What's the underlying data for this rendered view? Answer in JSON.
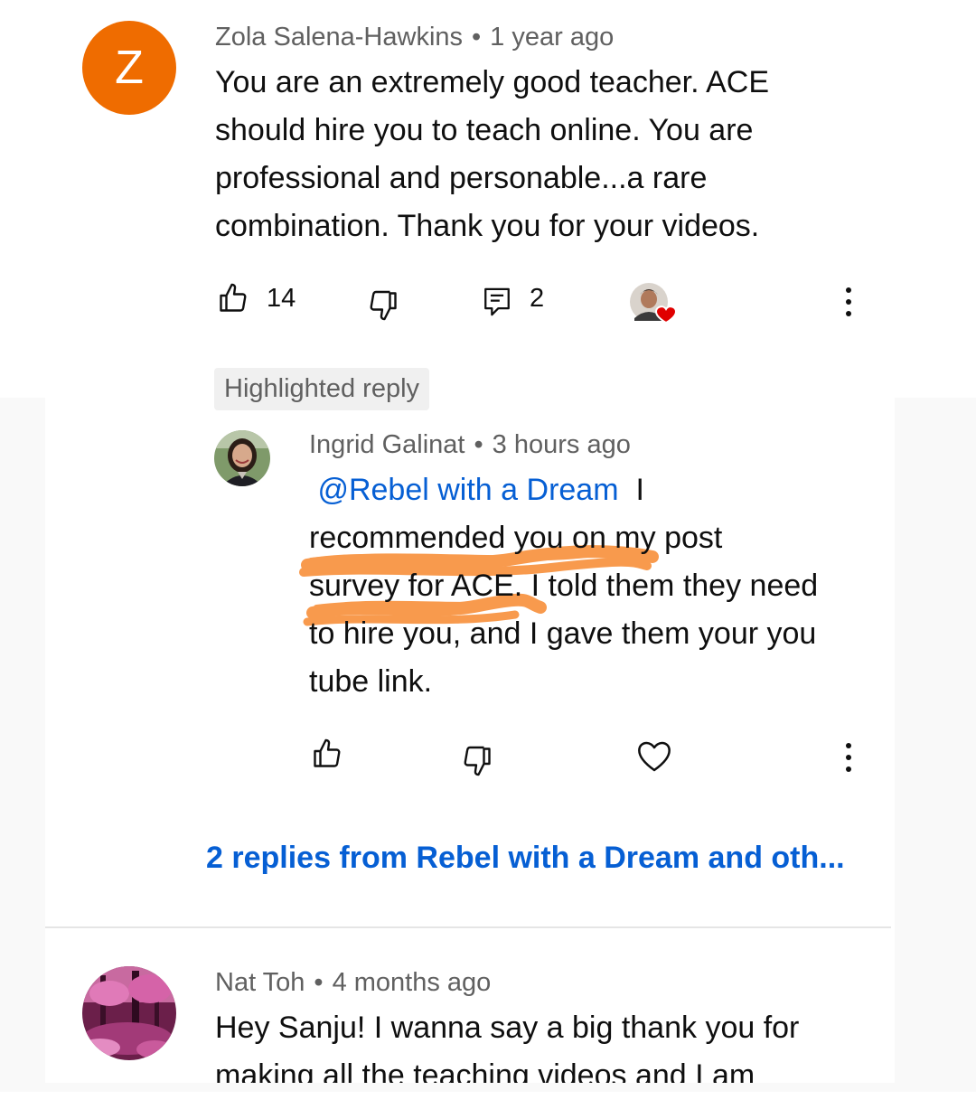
{
  "comment1": {
    "avatar_letter": "Z",
    "avatar_color": "#ef6c00",
    "author": "Zola Salena-Hawkins",
    "time": "1 year ago",
    "lines": [
      "You are an extremely good teacher.  ACE",
      "should hire you to teach online.  You are",
      "professional and personable...a rare",
      "combination.  Thank you for your videos."
    ],
    "like_count": "14",
    "reply_count": "2"
  },
  "reply": {
    "chip_label": "Highlighted reply",
    "author": "Ingrid Galinat",
    "time": "3 hours ago",
    "mention": "@Rebel with a Dream",
    "first_line_rest": "I",
    "lines": [
      "recommended you on my post",
      "survey for ACE. I told them they need",
      "to hire you, and I gave them your you",
      "tube link."
    ]
  },
  "more_replies_link": "2 replies from Rebel with a Dream and oth...",
  "comment2": {
    "author": "Nat Toh",
    "time": "4 months ago",
    "lines": [
      "Hey Sanju! I wanna say a big thank you for",
      "making all the teaching videos and I am"
    ]
  },
  "colors": {
    "link": "#065fd4",
    "meta": "#606060",
    "highlight_marker": "#f7892f",
    "heart": "#e00000"
  }
}
